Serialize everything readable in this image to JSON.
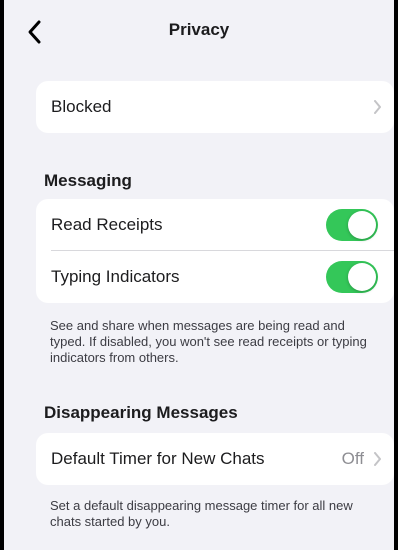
{
  "nav": {
    "title": "Privacy",
    "back_icon": "chevron-left-icon"
  },
  "blocked": {
    "label": "Blocked",
    "icon": "chevron-right-icon"
  },
  "messaging": {
    "header": "Messaging",
    "read_receipts": {
      "label": "Read Receipts",
      "enabled": true
    },
    "typing_indicators": {
      "label": "Typing Indicators",
      "enabled": true
    },
    "footnote": "See and share when messages are being read and typed. If disabled, you won't see read receipts or typing indicators from others."
  },
  "disappearing": {
    "header": "Disappearing Messages",
    "default_timer": {
      "label": "Default Timer for New Chats",
      "value": "Off"
    },
    "footnote": "Set a default disappearing message timer for all new chats started by you."
  },
  "colors": {
    "background": "#f2f2f7",
    "card": "#ffffff",
    "toggle_on": "#34c759",
    "secondary_text": "#8e8e93"
  }
}
